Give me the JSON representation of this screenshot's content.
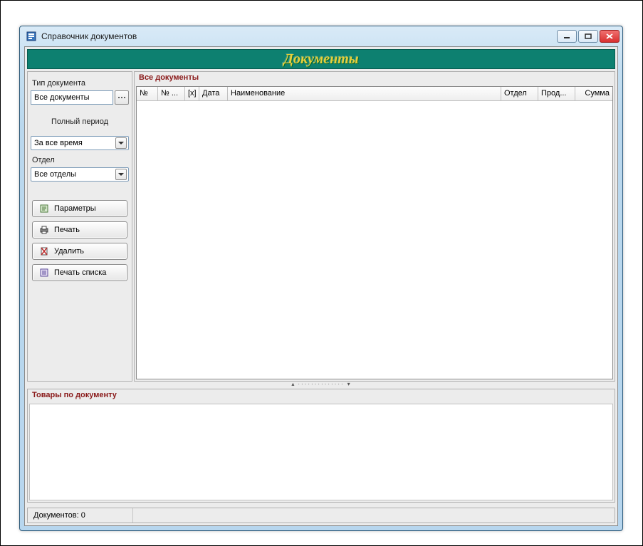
{
  "window": {
    "title": "Справочник документов"
  },
  "banner": {
    "title": "Документы"
  },
  "sidebar": {
    "doc_type_label": "Тип документа",
    "doc_type_value": "Все документы",
    "period_label": "Полный период",
    "period_value": "За все время",
    "dept_label": "Отдел",
    "dept_value": "Все отделы",
    "buttons": {
      "params": "Параметры",
      "print": "Печать",
      "delete": "Удалить",
      "print_list": "Печать списка"
    }
  },
  "grid": {
    "title": "Все документы",
    "columns": [
      "№",
      "№ ...",
      "[x]",
      "Дата",
      "Наименование",
      "Отдел",
      "Прод...",
      "Сумма"
    ]
  },
  "detail": {
    "title": "Товары по документу"
  },
  "status": {
    "count_label": "Документов: 0"
  }
}
